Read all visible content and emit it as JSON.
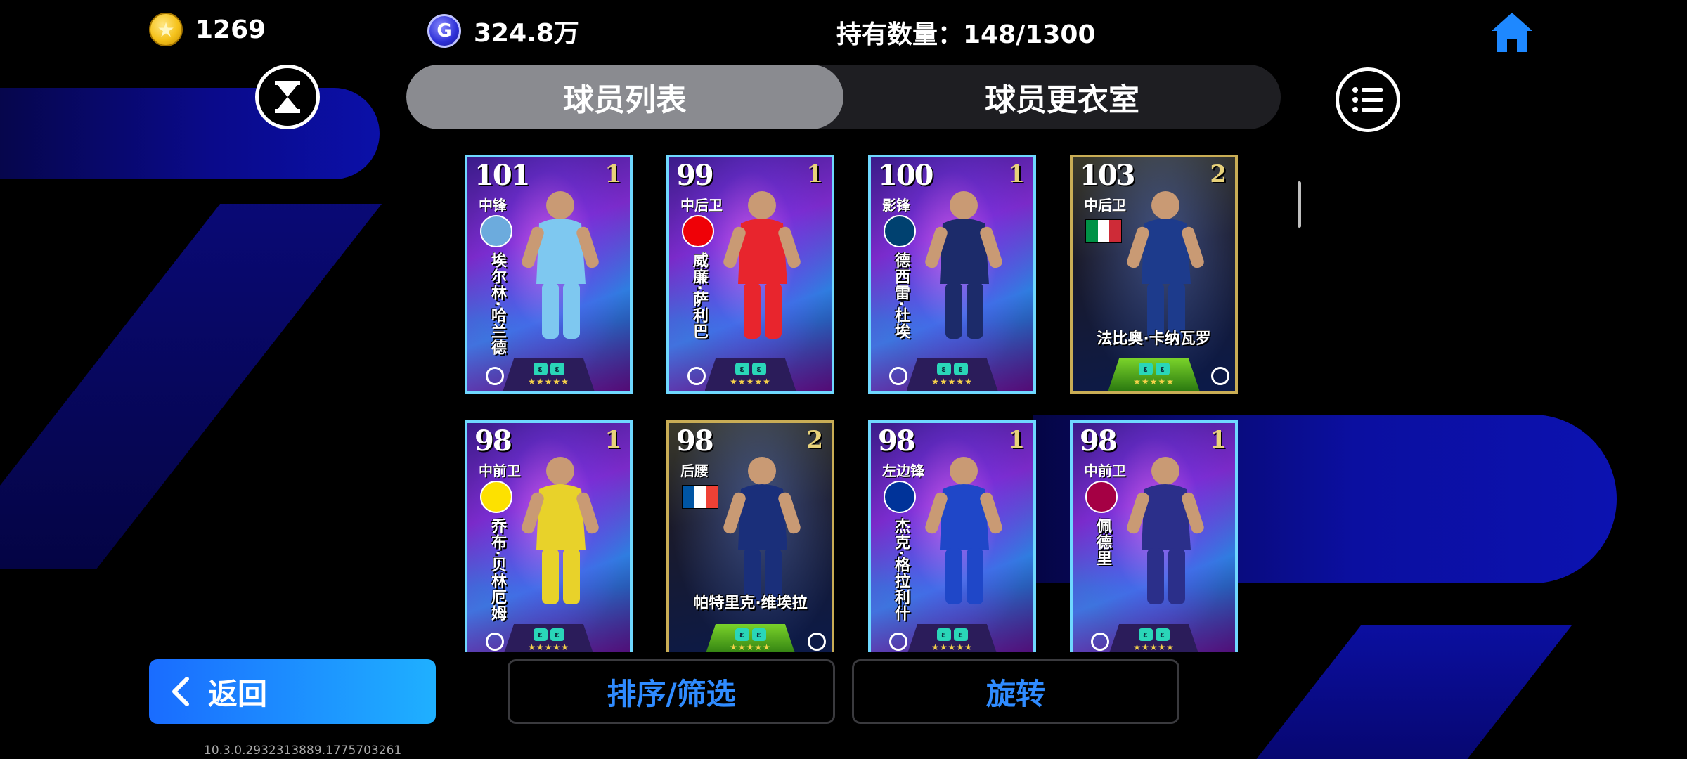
{
  "header": {
    "coins": "1269",
    "gp": "324.8万",
    "gp_icon_letter": "G",
    "hold_count": "持有数量：148/1300",
    "home_icon": "home-icon"
  },
  "tabs": [
    {
      "label": "球员列表",
      "active": true
    },
    {
      "label": "球员更衣室",
      "active": false
    }
  ],
  "cards": [
    {
      "rating": "101",
      "level": "1",
      "position": "中锋",
      "name": "埃尔林·哈兰德",
      "type": "standard",
      "club_color": "#6cabdd",
      "kit": "#7ec8f0"
    },
    {
      "rating": "99",
      "level": "1",
      "position": "中后卫",
      "name": "威廉·萨利巴",
      "type": "standard",
      "club_color": "#ef0107",
      "kit": "#e8252d"
    },
    {
      "rating": "100",
      "level": "1",
      "position": "影锋",
      "name": "德西雷·杜埃",
      "type": "standard",
      "club_color": "#004170",
      "kit": "#1c2b6a"
    },
    {
      "rating": "103",
      "level": "2",
      "position": "中后卫",
      "name": "法比奥·卡纳瓦罗",
      "type": "legend",
      "flag": [
        "#009246",
        "#ffffff",
        "#ce2b37"
      ],
      "kit": "#1d3b8c"
    },
    {
      "rating": "98",
      "level": "1",
      "position": "中前卫",
      "name": "乔布·贝林厄姆",
      "type": "standard",
      "club_color": "#fde100",
      "kit": "#e8d22a"
    },
    {
      "rating": "98",
      "level": "2",
      "position": "后腰",
      "name": "帕特里克·维埃拉",
      "type": "legend",
      "flag": [
        "#0055a4",
        "#ffffff",
        "#ef4135"
      ],
      "kit": "#1a2f7a"
    },
    {
      "rating": "98",
      "level": "1",
      "position": "左边锋",
      "name": "杰克·格拉利什",
      "type": "standard",
      "club_color": "#003399",
      "kit": "#1f47c8"
    },
    {
      "rating": "98",
      "level": "1",
      "position": "中前卫",
      "name": "佩德里",
      "type": "standard",
      "club_color": "#a50044",
      "kit": "#2b2f8a"
    }
  ],
  "footer": {
    "back_label": "返回",
    "sort_label": "排序/筛选",
    "rotate_label": "旋转",
    "version": "10.3.0.2932313889.1775703261"
  },
  "colors": {
    "accent_blue": "#1a6cff",
    "button_text_blue": "#2f8bff",
    "card_border": "#6fd8ff",
    "legend_border": "#c9ad55"
  }
}
